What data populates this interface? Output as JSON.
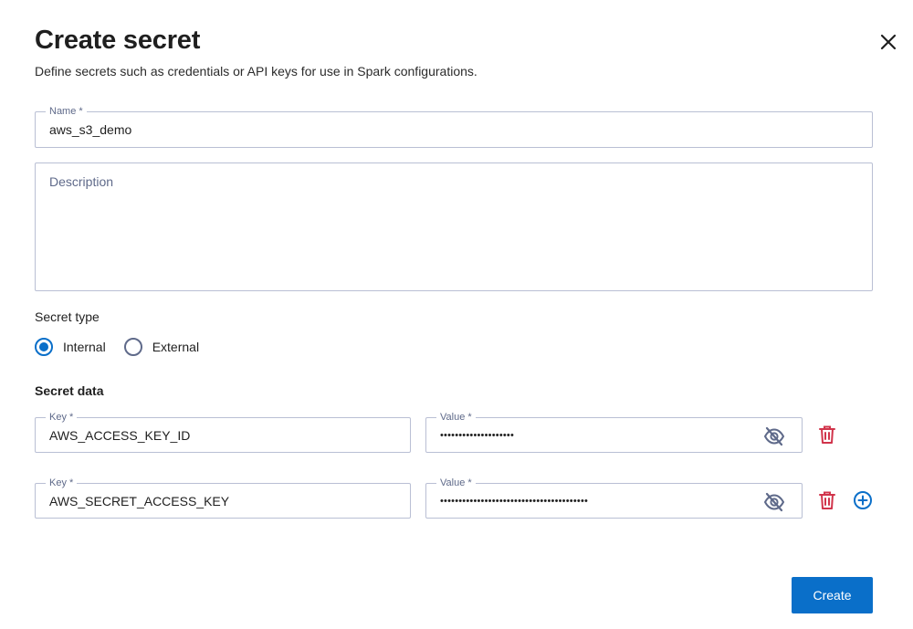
{
  "dialog": {
    "title": "Create secret",
    "subtitle": "Define secrets such as credentials or API keys for use in Spark configurations.",
    "close_icon": "close-icon"
  },
  "name_field": {
    "label": "Name *",
    "value": "aws_s3_demo"
  },
  "description_field": {
    "placeholder": "Description",
    "value": ""
  },
  "secret_type": {
    "label": "Secret type",
    "options": [
      {
        "label": "Internal",
        "selected": true
      },
      {
        "label": "External",
        "selected": false
      }
    ]
  },
  "secret_data": {
    "label": "Secret data",
    "rows": [
      {
        "key_label": "Key *",
        "key_value": "AWS_ACCESS_KEY_ID",
        "value_label": "Value *",
        "value_masked": "••••••••••••••••••••"
      },
      {
        "key_label": "Key *",
        "key_value": "AWS_SECRET_ACCESS_KEY",
        "value_label": "Value *",
        "value_masked": "••••••••••••••••••••••••••••••••••••••••"
      }
    ],
    "icons": {
      "visibility": "eye-off-icon",
      "delete": "trash-icon",
      "add": "plus-circle-icon"
    }
  },
  "actions": {
    "create_label": "Create"
  },
  "colors": {
    "primary": "#0a6fc9",
    "danger": "#d1344b",
    "border": "#b9bfd4",
    "label": "#5f6a8a"
  }
}
